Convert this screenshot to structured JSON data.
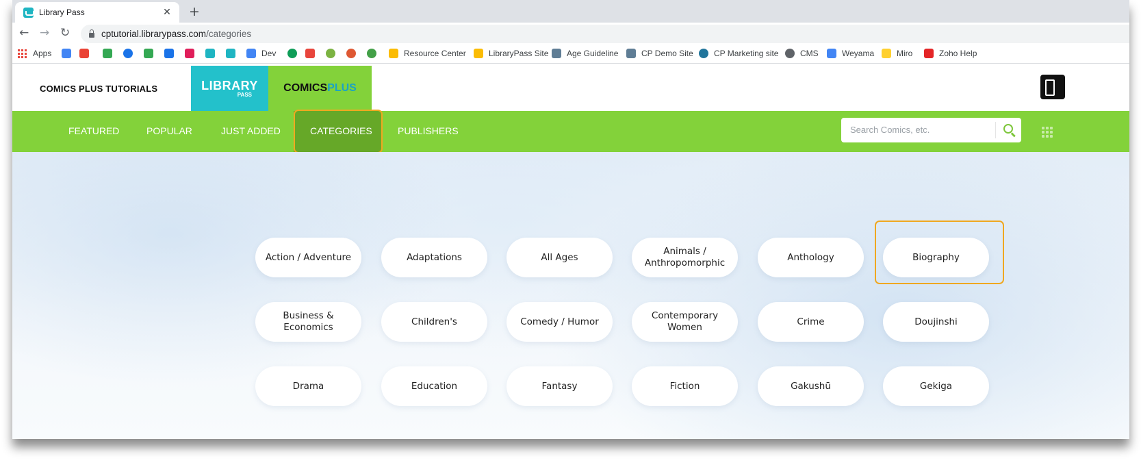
{
  "browser": {
    "tab_title": "Library Pass",
    "tab_close": "✕",
    "new_tab": "+",
    "url_host": "cptutorial.librarypass.com",
    "url_path": "/categories",
    "back": "←",
    "forward": "→",
    "reload": "↻",
    "bookmarks": [
      {
        "label": "Apps",
        "icon": "apps-grid-icon"
      },
      {
        "label": "",
        "icon": "calendar-icon",
        "color": "#4285f4"
      },
      {
        "label": "",
        "icon": "gmail-icon",
        "color": "#ea4335"
      },
      {
        "label": "",
        "icon": "drive-icon",
        "color": "#34a853"
      },
      {
        "label": "",
        "icon": "circle-c-icon",
        "color": "#1a73e8"
      },
      {
        "label": "",
        "icon": "leaf-icon",
        "color": "#34a853"
      },
      {
        "label": "",
        "icon": "qr-icon",
        "color": "#1a73e8"
      },
      {
        "label": "",
        "icon": "slack-icon",
        "color": "#e01e5a"
      },
      {
        "label": "",
        "icon": "librarypass-icon",
        "color": "#1fb5c2"
      },
      {
        "label": "",
        "icon": "librarypass-icon",
        "color": "#1fb5c2"
      },
      {
        "label": "Dev",
        "icon": "google-icon",
        "color": "#4285f4"
      },
      {
        "label": "",
        "icon": "cb-icon",
        "color": "#0f9d58"
      },
      {
        "label": "",
        "icon": "flow-icon",
        "color": "#e8453c"
      },
      {
        "label": "",
        "icon": "q-icon",
        "color": "#7cb342"
      },
      {
        "label": "",
        "icon": "duck-icon",
        "color": "#de5833"
      },
      {
        "label": "",
        "icon": "frog-icon",
        "color": "#43a047"
      },
      {
        "label": "Resource Center",
        "icon": "folder-icon",
        "color": "#fbbc04"
      },
      {
        "label": "LibraryPass Site",
        "icon": "folder-icon",
        "color": "#fbbc04"
      },
      {
        "label": "Age Guideline",
        "icon": "doc-icon",
        "color": "#5f7d95"
      },
      {
        "label": "CP Demo Site",
        "icon": "doc-icon",
        "color": "#5f7d95"
      },
      {
        "label": "CP Marketing site",
        "icon": "wordpress-icon",
        "color": "#21759b"
      },
      {
        "label": "CMS",
        "icon": "globe-icon",
        "color": "#5f6368"
      },
      {
        "label": "Weyama",
        "icon": "docs-icon",
        "color": "#4285f4"
      },
      {
        "label": "Miro",
        "icon": "miro-icon",
        "color": "#ffd02f"
      },
      {
        "label": "Zoho Help",
        "icon": "zoho-icon",
        "color": "#e42527"
      }
    ]
  },
  "site": {
    "title": "COMICS PLUS TUTORIALS",
    "logo_library": "LIBRARY",
    "logo_pass": "PASS",
    "logo_comics": "COMICS",
    "logo_plus": "PLUS"
  },
  "nav": {
    "items": [
      "FEATURED",
      "POPULAR",
      "JUST ADDED",
      "CATEGORIES",
      "PUBLISHERS"
    ],
    "active": "CATEGORIES",
    "search_placeholder": "Search Comics, etc.",
    "accent": "#83d23a",
    "active_bg": "#66a828",
    "highlight": "#f0a820"
  },
  "categories": [
    "Action / Adventure",
    "Adaptations",
    "All Ages",
    "Animals / Anthropomorphic",
    "Anthology",
    "Biography",
    "Business & Economics",
    "Children's",
    "Comedy / Humor",
    "Contemporary Women",
    "Crime",
    "Doujinshi",
    "Drama",
    "Education",
    "Fantasy",
    "Fiction",
    "Gakushū",
    "Gekiga"
  ],
  "highlighted_category": "Biography"
}
